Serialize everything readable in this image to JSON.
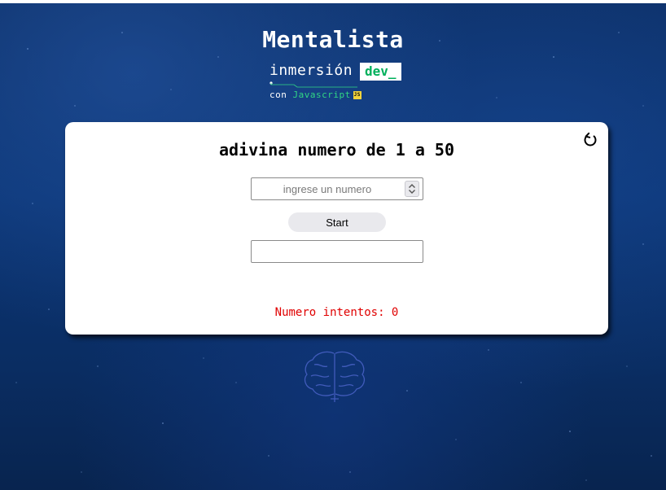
{
  "header": {
    "title": "Mentalista",
    "logo_word": "inmersión",
    "logo_dev": "dev_",
    "logo_con": "con",
    "logo_lang": "Javascript",
    "logo_badge": "JS"
  },
  "game": {
    "heading": "adivina numero de 1 a 50",
    "input_placeholder": "ingrese un numero",
    "input_value": "",
    "start_label": "Start",
    "result_value": "",
    "attempts_label": "Numero intentos: 0",
    "attempts_color": "#e00000"
  },
  "icons": {
    "restart": "restart-icon",
    "brain": "brain-icon"
  },
  "colors": {
    "background": "#0b3575",
    "card": "#ffffff",
    "dev_green": "#00b05b",
    "js_green": "#31d684",
    "js_yellow": "#f3d33c"
  }
}
